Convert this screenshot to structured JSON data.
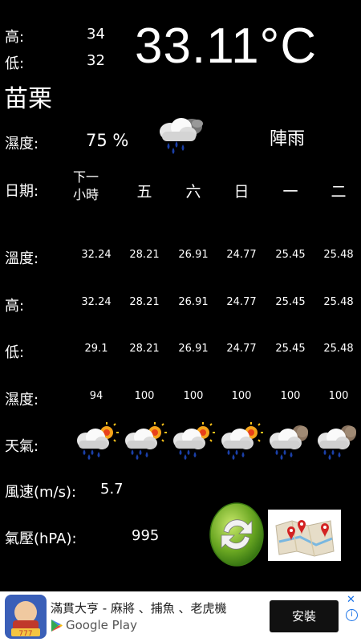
{
  "today": {
    "high_label": "高:",
    "high_value": "34",
    "low_label": "低:",
    "low_value": "32",
    "temperature": "33.11°C",
    "city": "苗栗",
    "humidity_label": "濕度:",
    "humidity_value": "75 %",
    "condition": "陣雨",
    "condition_icon": "rain-cloud-icon"
  },
  "forecast": {
    "date_label": "日期:",
    "columns": [
      "下一\n小時",
      "五",
      "六",
      "日",
      "一",
      "二"
    ],
    "rows": [
      {
        "label": "溫度:",
        "values": [
          "32.24",
          "28.21",
          "26.91",
          "24.77",
          "25.45",
          "25.48"
        ]
      },
      {
        "label": "高:",
        "values": [
          "32.24",
          "28.21",
          "26.91",
          "24.77",
          "25.45",
          "25.48"
        ]
      },
      {
        "label": "低:",
        "values": [
          "29.1",
          "28.21",
          "26.91",
          "24.77",
          "25.45",
          "25.48"
        ]
      },
      {
        "label": "濕度:",
        "values": [
          "94",
          "100",
          "100",
          "100",
          "100",
          "100"
        ]
      }
    ],
    "weather_label": "天氣:",
    "weather_icons": [
      "sun-rain-cloud-icon",
      "sun-rain-cloud-icon",
      "sun-rain-cloud-icon",
      "sun-rain-cloud-icon",
      "night-rain-cloud-icon",
      "night-rain-cloud-icon"
    ]
  },
  "wind": {
    "label": "風速(m/s):",
    "value": "5.7"
  },
  "pressure": {
    "label": "氣壓(hPA):",
    "value": "995"
  },
  "buttons": {
    "refresh_icon": "refresh-icon",
    "map_icon": "map-icon"
  },
  "ad": {
    "title": "滿貫大亨 - 麻將 、捕魚 、老虎機",
    "store": "Google Play",
    "install": "安裝",
    "colors": {
      "button_bg": "#111111",
      "close": "#1a73e8"
    }
  }
}
